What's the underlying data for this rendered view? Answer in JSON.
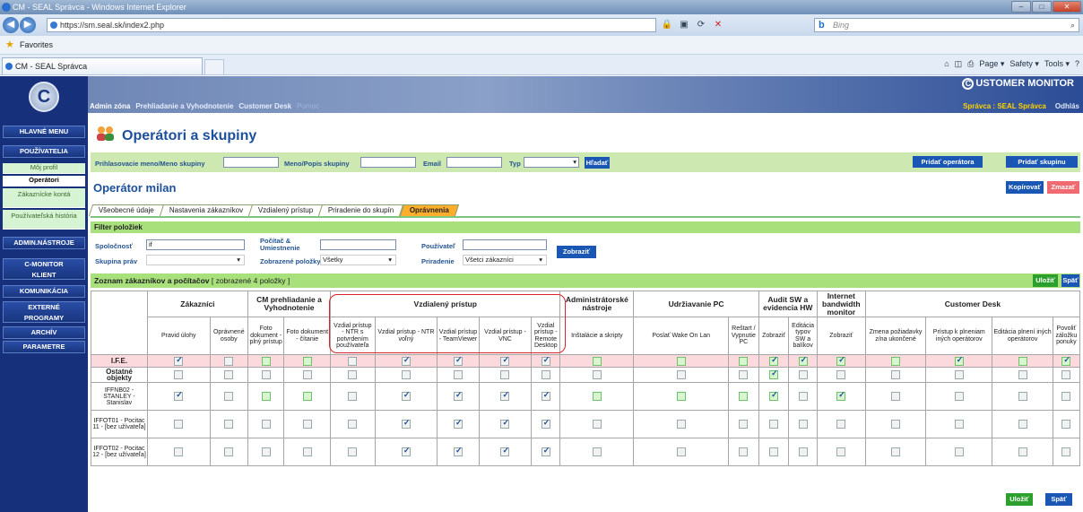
{
  "browser": {
    "window_title": "CM - SEAL Správca - Windows Internet Explorer",
    "url": "https://sm.seal.sk/index2.php",
    "search_placeholder": "Bing",
    "favorites": "Favorites",
    "tab_title": "CM - SEAL Správca",
    "commands": [
      "Page ▾",
      "Safety ▾",
      "Tools ▾"
    ]
  },
  "sidebar": {
    "logo": "C",
    "items": [
      {
        "label": "HLAVNÉ MENU"
      },
      {
        "label": "POUŽÍVATELIA"
      },
      {
        "label": "ADMIN.NÁSTROJE"
      },
      {
        "label": "C-MONITOR KLIENT"
      },
      {
        "label": "KOMUNIKÁCIA"
      },
      {
        "label": "EXTERNÉ PROGRAMY"
      },
      {
        "label": "ARCHÍV"
      },
      {
        "label": "PARAMETRE"
      }
    ],
    "subitems": [
      {
        "label": "Môj profil"
      },
      {
        "label": "Operátori"
      },
      {
        "label": "Zákaznícke kontá"
      },
      {
        "label": "Používateľská história"
      }
    ]
  },
  "header": {
    "brand": "USTOMER MONITOR",
    "brand_icon": "C",
    "menu": [
      "Admin zóna",
      "Prehliadanie a Vyhodnotenie",
      "Customer Desk",
      "Pomoc"
    ],
    "role_label": "Správca : SEAL Správca",
    "logout": "Odhlás"
  },
  "page_title": "Operátori a skupiny",
  "search": {
    "login_label": "Prihlasovacie meno/Meno skupiny",
    "name_label": "Meno/Popis skupiny",
    "email_label": "Email",
    "type_label": "Typ",
    "search_btn": "Hľadať",
    "add_operator_btn": "Pridať operátora",
    "add_group_btn": "Pridať skupinu"
  },
  "operator": {
    "title": "Operátor milan",
    "copy_btn": "Kopírovať",
    "delete_btn": "Zmazať"
  },
  "tabs": [
    "Všeobecné údaje",
    "Nastavenia zákazníkov",
    "Vzdialený prístup",
    "Priradenie do skupín",
    "Oprávnenia"
  ],
  "filter": {
    "title": "Filter položiek",
    "company_label": "Spoločnosť",
    "company_value": "if",
    "computer_label": "Počítač & Umiestnenie",
    "user_label": "Používateľ",
    "rights_group_label": "Skupina práv",
    "shown_items_label": "Zobrazené položky",
    "shown_items_value": "Všetky",
    "assignment_label": "Priradenie",
    "assignment_value": "Všetci zákazníci",
    "show_btn": "Zobraziť"
  },
  "list": {
    "title_prefix": "Zoznam zákazníkov a počítačov",
    "title_suffix": "[ zobrazené 4 položky ]",
    "save_btn": "Uložiť",
    "back_btn": "Späť"
  },
  "table": {
    "groups": [
      "Zákazníci",
      "CM prehliadanie a Vyhodnotenie",
      "Vzdialený prístup",
      "Administrátorské nástroje",
      "Udržiavanie PC",
      "Audit SW a evidencia HW",
      "Internet bandwidth monitor",
      "Customer Desk"
    ],
    "columns": [
      "Pravid úlohy",
      "Oprávnené osoby",
      "Foto dokument - plný prístup",
      "Foto dokument - čítanie",
      "Vzdial prístup - NTR s potvrdením používateľa",
      "Vzdial prístup - NTR voľný",
      "Vzdial prístup - TeamViewer",
      "Vzdial prístup - VNC",
      "Vzdial prístup - Remote Desktop",
      "Inštalácie a skripty",
      "Poslať Wake On Lan",
      "Reštart / Vypnutie PC",
      "Zobraziť",
      "Editácia typov SW a balíkov",
      "Zobraziť",
      "Zmena požiadavky z/na ukončené",
      "Prístup k plneniam iných operátorov",
      "Editácia plnení iných operátorov",
      "Povoliť záložku ponuky"
    ],
    "rows": [
      {
        "name": "I.F.E.",
        "checks": "cgcgggggggcggcgcgggcgggc"
      },
      {
        "name": "Ostatné objekty",
        "checks": ""
      },
      {
        "name": "IFFNB02 - STANLEY - Stanislav",
        "checks": ""
      },
      {
        "name": "IFFOT01 - Pocitac 11 - [bez užívateľa]",
        "checks": ""
      },
      {
        "name": "IFFOT02 - Pocitac 12 - [bez užívateľa]",
        "checks": ""
      }
    ]
  },
  "colors": {
    "accent": "#1a56b4",
    "green": "#a8e07c",
    "sidebar": "#16307c",
    "highlight": "#d9232a"
  }
}
